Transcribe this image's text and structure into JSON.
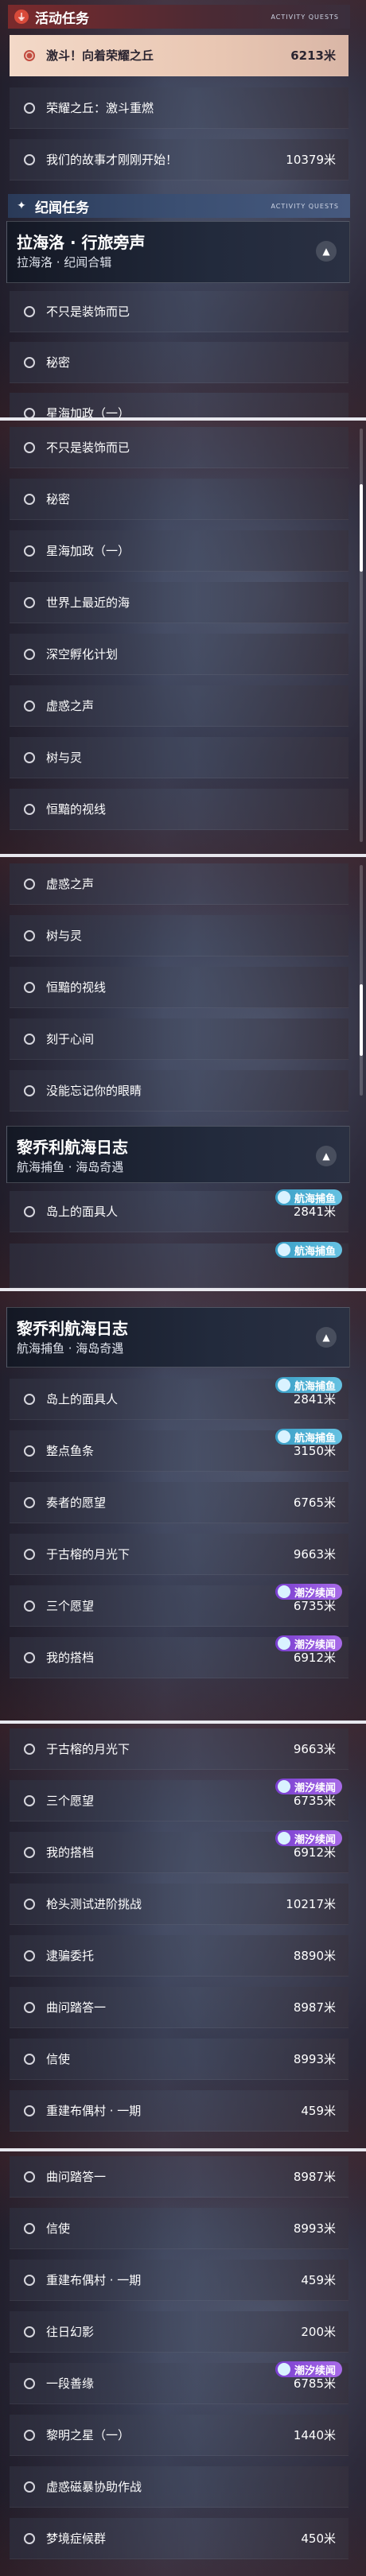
{
  "headers": {
    "activity": "活动任务",
    "annals": "纪闻任务"
  },
  "header_tag": "ACTIVITY QUESTS",
  "chapters": {
    "lahai": {
      "title": "拉海洛 · 行旅旁声",
      "subtitle": "拉海洛 · 纪闻合辑"
    },
    "lijiao": {
      "title": "黎乔利航海日志",
      "subtitle": "航海捕鱼 · 海岛奇遇"
    }
  },
  "badges": {
    "fishing": "航海捕鱼",
    "tide": "潮汐续闻"
  },
  "p1": {
    "rows": [
      {
        "label": "激斗！向着荣耀之丘",
        "dist": "6213米"
      },
      {
        "label": "荣耀之丘：激斗重燃",
        "dist": ""
      },
      {
        "label": "我们的故事才刚刚开始！",
        "dist": "10379米"
      },
      {
        "label": "不只是装饰而已",
        "dist": ""
      },
      {
        "label": "秘密",
        "dist": ""
      },
      {
        "label": "星海加政（一）",
        "dist": ""
      }
    ]
  },
  "p2": {
    "rows": [
      {
        "label": "不只是装饰而已"
      },
      {
        "label": "秘密"
      },
      {
        "label": "星海加政（一）"
      },
      {
        "label": "世界上最近的海"
      },
      {
        "label": "深空孵化计划"
      },
      {
        "label": "虚惑之声"
      },
      {
        "label": "树与灵"
      },
      {
        "label": "恒黯的视线"
      }
    ]
  },
  "p3": {
    "rows": [
      {
        "label": "虚惑之声"
      },
      {
        "label": "树与灵"
      },
      {
        "label": "恒黯的视线"
      },
      {
        "label": "刻于心间"
      },
      {
        "label": "没能忘记你的眼睛"
      },
      {
        "label": "岛上的面具人",
        "dist": "2841米"
      }
    ]
  },
  "p4": {
    "rows": [
      {
        "label": "岛上的面具人",
        "dist": "2841米"
      },
      {
        "label": "整点鱼条",
        "dist": "3150米"
      },
      {
        "label": "奏者的愿望",
        "dist": "6765米"
      },
      {
        "label": "于古榕的月光下",
        "dist": "9663米"
      },
      {
        "label": "三个愿望",
        "dist": "6735米"
      },
      {
        "label": "我的搭档",
        "dist": "6912米"
      }
    ]
  },
  "p5": {
    "rows": [
      {
        "label": "于古榕的月光下",
        "dist": "9663米"
      },
      {
        "label": "三个愿望",
        "dist": "6735米"
      },
      {
        "label": "我的搭档",
        "dist": "6912米"
      },
      {
        "label": "枪头测试进阶挑战",
        "dist": "10217米"
      },
      {
        "label": "逮骗委托",
        "dist": "8890米"
      },
      {
        "label": "曲问踏答一",
        "dist": "8987米"
      },
      {
        "label": "信使",
        "dist": "8993米"
      },
      {
        "label": "重建布偶村 · 一期",
        "dist": "459米"
      }
    ]
  },
  "p6": {
    "rows": [
      {
        "label": "曲问踏答一",
        "dist": "8987米"
      },
      {
        "label": "信使",
        "dist": "8993米"
      },
      {
        "label": "重建布偶村 · 一期",
        "dist": "459米"
      },
      {
        "label": "往日幻影",
        "dist": "200米"
      },
      {
        "label": "一段善缘",
        "dist": "6785米"
      },
      {
        "label": "黎明之星（一）",
        "dist": "1440米"
      },
      {
        "label": "虚惑磁暴协助作战",
        "dist": ""
      },
      {
        "label": "梦境症候群",
        "dist": "450米"
      }
    ]
  }
}
